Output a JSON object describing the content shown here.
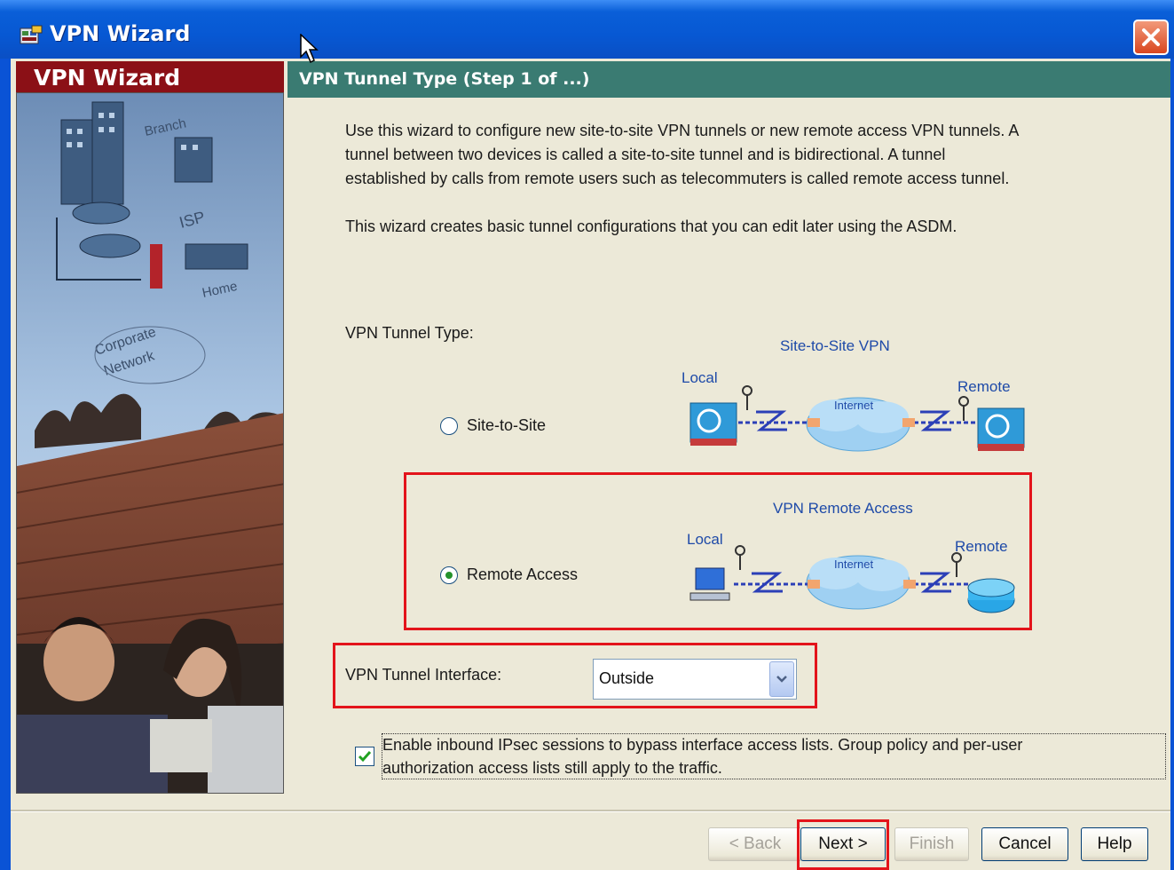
{
  "window": {
    "title": "VPN Wizard"
  },
  "sidebar": {
    "header": "VPN Wizard",
    "art_labels": [
      "Branch",
      "ISP",
      "Home",
      "Corporate",
      "Network"
    ]
  },
  "step": {
    "title": "VPN Tunnel Type  (Step 1 of ...)"
  },
  "intro": {
    "line1": "Use this wizard to configure new site-to-site VPN tunnels or new remote access VPN tunnels. A",
    "line2": "tunnel between two devices is called a site-to-site tunnel and is bidirectional. A tunnel",
    "line3": "established by calls from remote users such as telecommuters is called remote access tunnel.",
    "line4": "This wizard creates basic tunnel configurations that you can edit later using the ASDM."
  },
  "tunnel_type": {
    "label": "VPN Tunnel Type:",
    "options": [
      {
        "label": "Site-to-Site",
        "selected": false
      },
      {
        "label": "Remote Access",
        "selected": true
      }
    ]
  },
  "diagrams": {
    "site_to_site": {
      "title": "Site-to-Site VPN",
      "local": "Local",
      "remote": "Remote",
      "cloud": "Internet"
    },
    "remote_access": {
      "title": "VPN Remote Access",
      "local": "Local",
      "remote": "Remote",
      "cloud": "Internet"
    }
  },
  "interface": {
    "label": "VPN Tunnel Interface:",
    "value": "Outside"
  },
  "bypass": {
    "checked": true,
    "line1": "Enable inbound IPsec sessions to bypass interface access lists. Group policy and per-user",
    "line2": "authorization access lists still apply to the traffic."
  },
  "buttons": {
    "back": "< Back",
    "next": "Next >",
    "finish": "Finish",
    "cancel": "Cancel",
    "help": "Help"
  },
  "colors": {
    "titlebar": "#0a5fd8",
    "sidebar_header": "#8b1016",
    "step_header": "#3a7b72",
    "highlight": "#e3141b",
    "diagram_text": "#1e4aa8"
  }
}
